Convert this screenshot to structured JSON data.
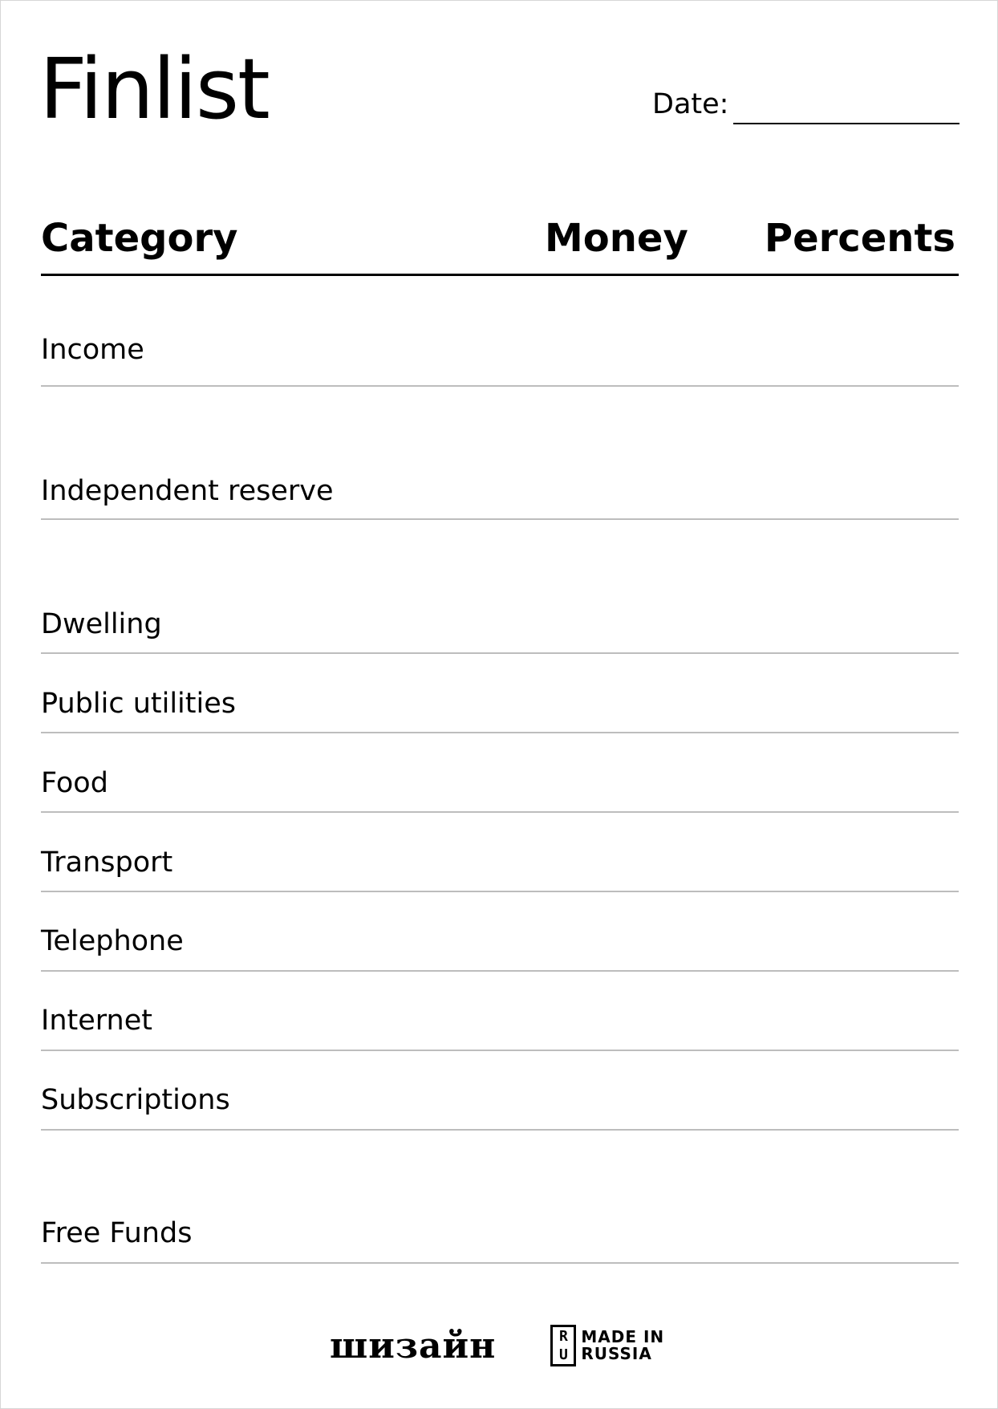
{
  "header": {
    "title": "Finlist",
    "date_label": "Date:"
  },
  "columns": {
    "category": "Category",
    "money": "Money",
    "percents": "Percents"
  },
  "rows": [
    "Income",
    "Independent reserve",
    "Dwelling",
    "Public utilities",
    "Food",
    "Transport",
    "Telephone",
    "Internet",
    "Subscriptions",
    "Free Funds"
  ],
  "footer": {
    "brand_wordmark": "шизайн",
    "badge_letters": [
      "R",
      "U"
    ],
    "badge_line1": "MADE IN",
    "badge_line2": "RUSSIA"
  }
}
